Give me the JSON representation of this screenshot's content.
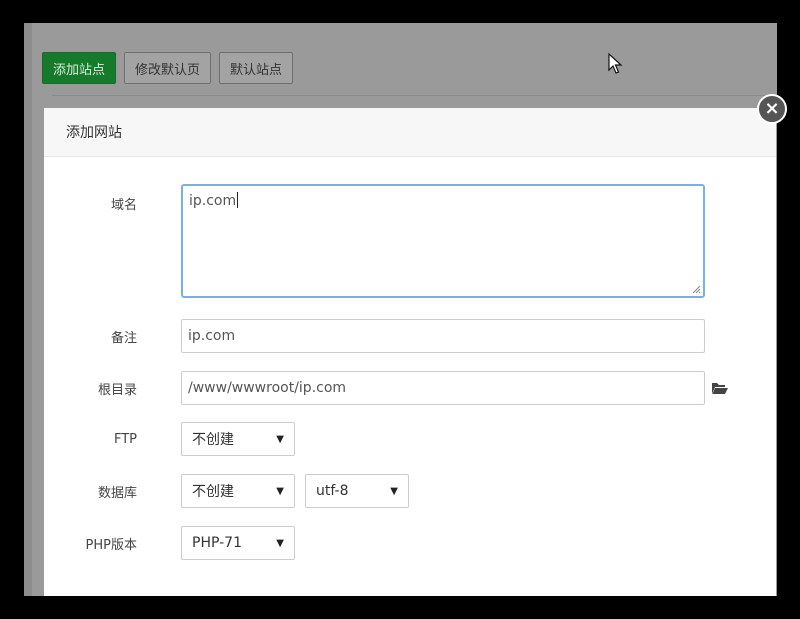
{
  "toolbar": {
    "add_site": "添加站点",
    "modify_default_page": "修改默认页",
    "default_site": "默认站点"
  },
  "modal": {
    "title": "添加网站",
    "close_glyph": "×",
    "domain": {
      "label": "域名",
      "value": "ip.com"
    },
    "remark": {
      "label": "备注",
      "value": "ip.com"
    },
    "root_dir": {
      "label": "根目录",
      "value": "/www/wwwroot/ip.com",
      "icon": "folder-open-icon"
    },
    "ftp": {
      "label": "FTP",
      "selected": "不创建"
    },
    "database": {
      "label": "数据库",
      "selected": "不创建",
      "charset": "utf-8"
    },
    "php": {
      "label": "PHP版本",
      "selected": "PHP-71"
    }
  },
  "colors": {
    "primary": "#167a2c",
    "focus_border": "#78b0e6"
  }
}
